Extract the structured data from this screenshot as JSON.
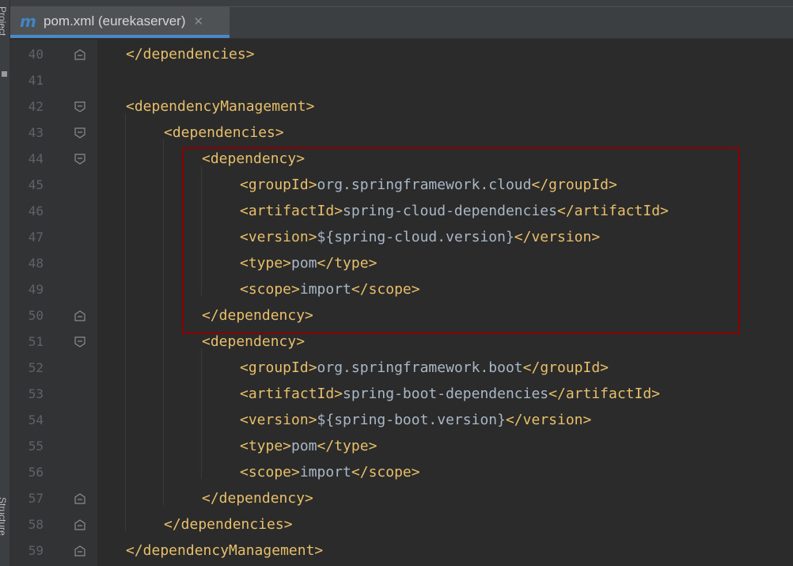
{
  "sidebar": {
    "project_label": "Project",
    "structure_label": "Structure"
  },
  "tab": {
    "icon": "m",
    "title": "pom.xml (eurekaserver)",
    "close": "✕"
  },
  "lines": [
    {
      "num": "40",
      "indent": 0,
      "open": "</dependencies>",
      "text": "",
      "close": "",
      "fold": "end"
    },
    {
      "num": "41",
      "indent": 0,
      "open": "",
      "text": "",
      "close": "",
      "fold": ""
    },
    {
      "num": "42",
      "indent": 0,
      "open": "<dependencyManagement>",
      "text": "",
      "close": "",
      "fold": "start"
    },
    {
      "num": "43",
      "indent": 1,
      "open": "<dependencies>",
      "text": "",
      "close": "",
      "fold": "start"
    },
    {
      "num": "44",
      "indent": 2,
      "open": "<dependency>",
      "text": "",
      "close": "",
      "fold": "start"
    },
    {
      "num": "45",
      "indent": 3,
      "open": "<groupId>",
      "text": "org.springframework.cloud",
      "close": "</groupId>",
      "fold": ""
    },
    {
      "num": "46",
      "indent": 3,
      "open": "<artifactId>",
      "text": "spring-cloud-dependencies",
      "close": "</artifactId>",
      "fold": ""
    },
    {
      "num": "47",
      "indent": 3,
      "open": "<version>",
      "text": "${spring-cloud.version}",
      "close": "</version>",
      "fold": ""
    },
    {
      "num": "48",
      "indent": 3,
      "open": "<type>",
      "text": "pom",
      "close": "</type>",
      "fold": ""
    },
    {
      "num": "49",
      "indent": 3,
      "open": "<scope>",
      "text": "import",
      "close": "</scope>",
      "fold": ""
    },
    {
      "num": "50",
      "indent": 2,
      "open": "</dependency>",
      "text": "",
      "close": "",
      "fold": "end"
    },
    {
      "num": "51",
      "indent": 2,
      "open": "<dependency>",
      "text": "",
      "close": "",
      "fold": "start"
    },
    {
      "num": "52",
      "indent": 3,
      "open": "<groupId>",
      "text": "org.springframework.boot",
      "close": "</groupId>",
      "fold": ""
    },
    {
      "num": "53",
      "indent": 3,
      "open": "<artifactId>",
      "text": "spring-boot-dependencies",
      "close": "</artifactId>",
      "fold": ""
    },
    {
      "num": "54",
      "indent": 3,
      "open": "<version>",
      "text": "${spring-boot.version}",
      "close": "</version>",
      "fold": ""
    },
    {
      "num": "55",
      "indent": 3,
      "open": "<type>",
      "text": "pom",
      "close": "</type>",
      "fold": ""
    },
    {
      "num": "56",
      "indent": 3,
      "open": "<scope>",
      "text": "import",
      "close": "</scope>",
      "fold": ""
    },
    {
      "num": "57",
      "indent": 2,
      "open": "</dependency>",
      "text": "",
      "close": "",
      "fold": "end"
    },
    {
      "num": "58",
      "indent": 1,
      "open": "</dependencies>",
      "text": "",
      "close": "",
      "fold": "end"
    },
    {
      "num": "59",
      "indent": 0,
      "open": "</dependencyManagement>",
      "text": "",
      "close": "",
      "fold": "end"
    }
  ],
  "colors": {
    "tag": "#e8bf6a",
    "text": "#a9b7c6",
    "highlight": "#8b0000",
    "tab_underline": "#4a88c7"
  },
  "icons": {
    "fold_start": "fold-start-icon",
    "fold_end": "fold-end-icon",
    "file": "maven-file-icon",
    "close": "close-icon"
  }
}
